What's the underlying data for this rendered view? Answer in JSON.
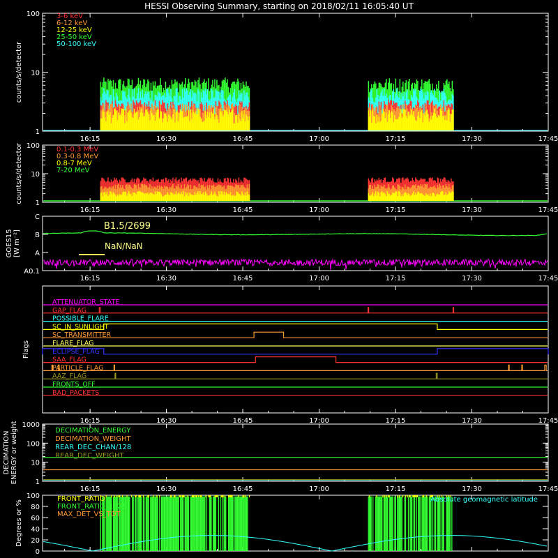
{
  "title": "HESSI Observing Summary, starting on 2018/02/11 16:05:40 UT",
  "x_axis": {
    "start_minutes": 965.6667,
    "end_minutes": 1065,
    "ticks": [
      {
        "label": "16:15",
        "min": 975
      },
      {
        "label": "16:30",
        "min": 990
      },
      {
        "label": "16:45",
        "min": 1005
      },
      {
        "label": "17:00",
        "min": 1020
      },
      {
        "label": "17:15",
        "min": 1035
      },
      {
        "label": "17:30",
        "min": 1050
      },
      {
        "label": "17:45",
        "min": 1065
      }
    ]
  },
  "chart_data": [
    {
      "type": "bar",
      "ylabel": "counts/s/detector",
      "yscale": "log",
      "ylim": [
        1,
        100
      ],
      "ytick_labels": [
        "1",
        "10",
        "100"
      ],
      "legend": [
        {
          "name": "3-6 keV",
          "color": "#ff3333"
        },
        {
          "name": "6-12 keV",
          "color": "#ff9933"
        },
        {
          "name": "12-25 keV",
          "color": "#ffff00"
        },
        {
          "name": "25-50 keV",
          "color": "#33ff33"
        },
        {
          "name": "50-100 keV",
          "color": "#33ffff"
        }
      ],
      "observing_intervals": [
        [
          977.0,
          1006.3
        ],
        [
          1029.6,
          1046.3
        ]
      ],
      "series": [
        {
          "name": "3-6 keV",
          "color": "#ff3333",
          "approx_level": 2.5
        },
        {
          "name": "6-12 keV",
          "color": "#ff9933",
          "approx_level": 2.2
        },
        {
          "name": "12-25 keV",
          "color": "#ffff00",
          "approx_level": 1.8
        },
        {
          "name": "25-50 keV",
          "color": "#33ff33",
          "approx_level": 6
        },
        {
          "name": "50-100 keV",
          "color": "#33ffff",
          "approx_level": 4
        }
      ]
    },
    {
      "type": "bar",
      "ylabel": "counts/s/detector",
      "yscale": "log",
      "ylim": [
        1,
        100
      ],
      "ytick_labels": [
        "1",
        "10",
        "100"
      ],
      "legend": [
        {
          "name": "0.1-0.3 MeV",
          "color": "#ff3333"
        },
        {
          "name": "0.3-0.8 MeV",
          "color": "#ff9933"
        },
        {
          "name": "0.8-7 MeV",
          "color": "#ffff00"
        },
        {
          "name": "7-20 MeV",
          "color": "#33ff33"
        }
      ],
      "observing_intervals": [
        [
          977.0,
          1006.3
        ],
        [
          1029.6,
          1046.3
        ]
      ],
      "series": [
        {
          "name": "0.1-0.3 MeV",
          "color": "#ff3333",
          "approx_level": 6
        },
        {
          "name": "0.3-0.8 MeV",
          "color": "#ff9933",
          "approx_level": 3.5
        },
        {
          "name": "0.8-7 MeV",
          "color": "#ffff00",
          "approx_level": 2
        },
        {
          "name": "7-20 MeV",
          "color": "#33ff33",
          "approx_level": 1
        }
      ]
    },
    {
      "type": "line",
      "ylabel": "GOES15",
      "ylabel2": "[W m⁻²]",
      "yticks": [
        {
          "label": "C",
          "v": 3
        },
        {
          "label": "B",
          "v": 2
        },
        {
          "label": "A",
          "v": 1
        },
        {
          "label": "A0.1",
          "v": 0
        }
      ],
      "ylim": [
        0,
        3
      ],
      "annotations": [
        {
          "text": "B1.5/2699",
          "color": "#ffff88"
        },
        {
          "text": "NaN/NaN",
          "color": "#ffff88"
        }
      ],
      "series": [
        {
          "name": "GOES long",
          "color": "#33ff33",
          "approx_level": 2.1
        },
        {
          "name": "GOES short",
          "color": "#ff00ff",
          "approx_level": 0.5
        }
      ]
    },
    {
      "type": "line",
      "ylabel": "Flags",
      "flags": [
        {
          "name": "ATTENUATOR_STATE",
          "color": "#ff00ff",
          "events": []
        },
        {
          "name": "GAP_FLAG",
          "color": "#ff3333",
          "events": [
            [
              976.8,
              977.0
            ],
            [
              1029.6,
              1029.6
            ],
            [
              1046.3,
              1046.3
            ]
          ]
        },
        {
          "name": "POSSIBLE_FLARE",
          "color": "#33ffff",
          "events": []
        },
        {
          "name": "SC_IN_SUNLIGHT",
          "color": "#ffff00",
          "events": [
            [
              977.7,
              1043.2
            ]
          ]
        },
        {
          "name": "SC_TRANSMITTER",
          "color": "#ff9933",
          "events": [
            [
              1007.2,
              1013.0
            ]
          ]
        },
        {
          "name": "FLARE_FLAG",
          "color": "#ffff66",
          "events": []
        },
        {
          "name": "ECLIPSE_FLAG",
          "color": "#3333ff",
          "events": [
            [
              965.6667,
              977.7
            ],
            [
              1043.2,
              1065
            ]
          ]
        },
        {
          "name": "SAA_FLAG",
          "color": "#ff3333",
          "events": [
            [
              1007.5,
              1023.3
            ]
          ]
        },
        {
          "name": "PARTICLE_FLAG",
          "color": "#ff9933",
          "events": [
            [
              967.5,
              967.6
            ],
            [
              968.8,
              968.9
            ],
            [
              979.7,
              979.8
            ],
            [
              1057.2,
              1057.3
            ],
            [
              1059.8,
              1059.9
            ],
            [
              1064.3,
              1064.6
            ]
          ]
        },
        {
          "name": "AAZ_FLAG",
          "color": "#999922",
          "events": [
            [
              979.9,
              980.0
            ],
            [
              1043.0,
              1043.2
            ]
          ]
        },
        {
          "name": "FRONTS_OFF",
          "color": "#33ff33",
          "events": []
        },
        {
          "name": "BAD_PACKETS",
          "color": "#ff3333",
          "events": []
        }
      ]
    },
    {
      "type": "line",
      "ylabel": "DECIMATION",
      "ylabel2": "ENERGY or weight",
      "yscale": "log",
      "ylim": [
        1,
        1000
      ],
      "ytick_labels": [
        "1",
        "10",
        "100",
        "1000"
      ],
      "series": [
        {
          "name": "DECIMATION_ENERGY",
          "color": "#33ff33",
          "approx_level": 18
        },
        {
          "name": "DECIMATION_WEIGHT",
          "color": "#ff9933",
          "approx_level": 4
        },
        {
          "name": "REAR_DEC_CHAN/128",
          "color": "#33ffff",
          "approx_level": 1
        },
        {
          "name": "REAR_DEC_WEIGHT",
          "color": "#999922",
          "approx_level": 1
        }
      ]
    },
    {
      "type": "line",
      "ylabel": "Degrees or %",
      "ylim": [
        0,
        100
      ],
      "ytick_labels": [
        "0",
        "20",
        "40",
        "60",
        "80",
        "100"
      ],
      "legend": [
        {
          "name": "FRONT_RATIO",
          "color": "#ffff00"
        },
        {
          "name": "FRONT_RATIO_1225",
          "color": "#33ff33"
        },
        {
          "name": "MAX_DET_VS_TOT",
          "color": "#ff9933"
        }
      ],
      "right_legend": {
        "name": "Absolute geomagnetic latitude",
        "color": "#33ffff"
      },
      "observing_intervals": [
        [
          977.0,
          1006.3
        ],
        [
          1029.6,
          1046.3
        ]
      ],
      "latitude_curve": {
        "max_deg": 28,
        "zero_at_min": [
          975.5,
          1022.5
        ],
        "peak_at_min": [
          998.0,
          1045.0
        ]
      }
    }
  ]
}
